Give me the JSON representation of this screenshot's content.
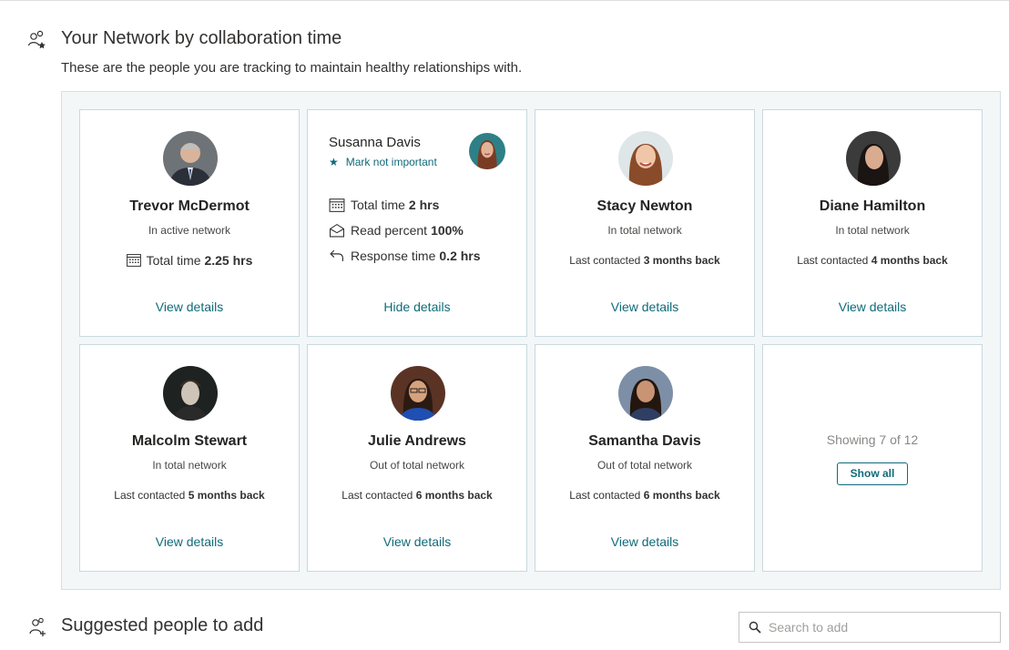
{
  "network": {
    "icon": "people-star-icon",
    "title": "Your Network by collaboration time",
    "subtitle": "These are the people you are tracking to maintain healthy relationships with."
  },
  "cards": [
    {
      "name": "Trevor McDermot",
      "status": "In active network",
      "metric_prefix": "Total time",
      "metric_value": "2.25 hrs",
      "link": "View details"
    },
    {
      "name": "Susanna Davis",
      "mark": "Mark not important",
      "total_label": "Total time",
      "total_value": "2 hrs",
      "read_label": "Read percent",
      "read_value": "100%",
      "response_label": "Response time",
      "response_value": "0.2 hrs",
      "link": "Hide details"
    },
    {
      "name": "Stacy Newton",
      "status": "In total network",
      "metric_prefix": "Last contacted",
      "metric_value": "3 months back",
      "link": "View details"
    },
    {
      "name": "Diane Hamilton",
      "status": "In total network",
      "metric_prefix": "Last contacted",
      "metric_value": "4 months back",
      "link": "View details"
    },
    {
      "name": "Malcolm Stewart",
      "status": "In total network",
      "metric_prefix": "Last contacted",
      "metric_value": "5 months back",
      "link": "View details"
    },
    {
      "name": "Julie Andrews",
      "status": "Out of total network",
      "metric_prefix": "Last contacted",
      "metric_value": "6 months back",
      "link": "View details"
    },
    {
      "name": "Samantha Davis",
      "status": "Out of total network",
      "metric_prefix": "Last contacted",
      "metric_value": "6 months back",
      "link": "View details"
    }
  ],
  "summary": {
    "showing": "Showing 7 of 12",
    "show_all": "Show all"
  },
  "suggested": {
    "icon": "person-add-icon",
    "title": "Suggested people to add",
    "search_placeholder": "Search to add"
  },
  "colors": {
    "accent": "#0f6b7a",
    "panel_bg": "#f3f7f8",
    "card_border": "#c8d9de"
  }
}
